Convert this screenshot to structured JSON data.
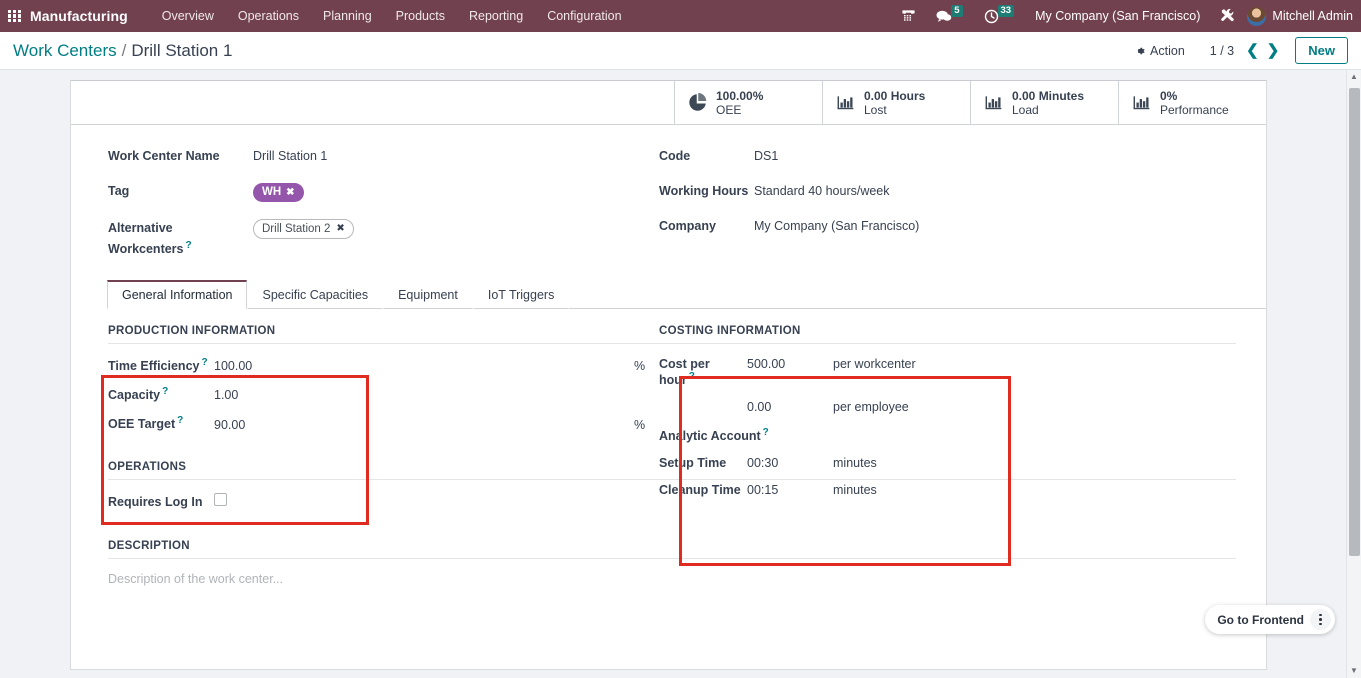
{
  "navbar": {
    "apps_icon": "apps-grid-icon",
    "brand": "Manufacturing",
    "menu": [
      {
        "label": "Overview"
      },
      {
        "label": "Operations"
      },
      {
        "label": "Planning"
      },
      {
        "label": "Products"
      },
      {
        "label": "Reporting"
      },
      {
        "label": "Configuration"
      }
    ],
    "voip_icon": "phone-icon",
    "messages_icon": "chat-bubble-icon",
    "messages_count": "5",
    "activities_icon": "clock-icon",
    "activities_count": "33",
    "company": "My Company (San Francisco)",
    "debug_icon": "tools-icon",
    "avatar_icon": "user-avatar",
    "user": "Mitchell Admin",
    "accent": "#71414f",
    "badge_color": "#1d7c74"
  },
  "control_panel": {
    "breadcrumb_root": "Work Centers",
    "breadcrumb_separator": "/",
    "breadcrumb_current": "Drill Station 1",
    "action_icon": "gear-icon",
    "action_label": "Action",
    "pager": "1 / 3",
    "prev_icon": "chevron-left-icon",
    "next_icon": "chevron-right-icon",
    "new_label": "New",
    "accent": "#017e84"
  },
  "stat_buttons": [
    {
      "icon": "pie-chart-icon",
      "value": "100.00%",
      "label": "OEE"
    },
    {
      "icon": "bar-chart-icon",
      "value": "0.00 Hours",
      "label": "Lost"
    },
    {
      "icon": "bar-chart-icon",
      "value": "0.00 Minutes",
      "label": "Load"
    },
    {
      "icon": "bar-chart-icon",
      "value": "0%",
      "label": "Performance"
    }
  ],
  "form": {
    "left": {
      "work_center_name_label": "Work Center Name",
      "work_center_name_value": "Drill Station 1",
      "tag_label": "Tag",
      "tag_value": "WH",
      "tag_remove_icon": "remove-tag-icon",
      "alt_label_line1": "Alternative",
      "alt_label_line2": "Workcenters",
      "alt_value": "Drill Station 2",
      "alt_remove_icon": "remove-tag-icon"
    },
    "right": {
      "code_label": "Code",
      "code_value": "DS1",
      "working_hours_label": "Working Hours",
      "working_hours_value": "Standard 40 hours/week",
      "company_label": "Company",
      "company_value": "My Company (San Francisco)"
    }
  },
  "tabs": [
    {
      "label": "General Information",
      "active": true
    },
    {
      "label": "Specific Capacities",
      "active": false
    },
    {
      "label": "Equipment",
      "active": false
    },
    {
      "label": "IoT Triggers",
      "active": false
    }
  ],
  "production_information": {
    "title": "PRODUCTION INFORMATION",
    "rows": [
      {
        "label": "Time Efficiency",
        "value": "100.00",
        "unit": "%",
        "help": true
      },
      {
        "label": "Capacity",
        "value": "1.00",
        "unit": "",
        "help": true
      },
      {
        "label": "OEE Target",
        "value": "90.00",
        "unit": "%",
        "help": true
      }
    ]
  },
  "costing_information": {
    "title": "COSTING INFORMATION",
    "rows": [
      {
        "label": "Cost per hour",
        "value": "500.00",
        "unit": "per workcenter",
        "help": true
      },
      {
        "label": "",
        "value": "0.00",
        "unit": "per employee",
        "help": false
      },
      {
        "label": "Analytic Account",
        "value": "",
        "unit": "",
        "help": true
      },
      {
        "label": "Setup Time",
        "value": "00:30",
        "unit": "minutes",
        "help": false
      },
      {
        "label": "Cleanup Time",
        "value": "00:15",
        "unit": "minutes",
        "help": false
      }
    ]
  },
  "operations": {
    "title": "OPERATIONS",
    "requires_login_label": "Requires Log In",
    "requires_login_checked": false
  },
  "description": {
    "title": "DESCRIPTION",
    "placeholder": "Description of the work center..."
  },
  "frontend": {
    "label": "Go to Frontend",
    "menu_icon": "kebab-menu-icon"
  },
  "scrollbar": {
    "up_icon": "scroll-up-icon",
    "down_icon": "scroll-down-icon"
  },
  "annotation_color": "#e02b20"
}
